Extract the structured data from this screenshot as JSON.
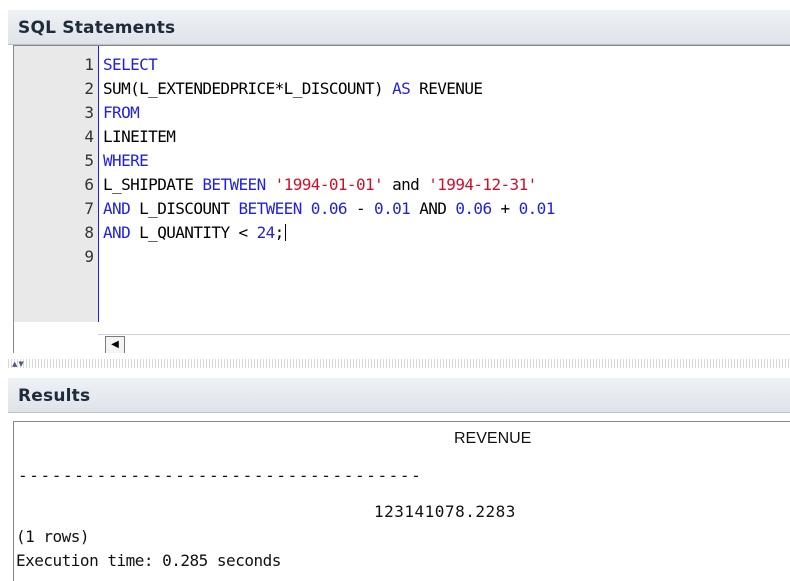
{
  "sql_panel": {
    "title": "SQL Statements",
    "line_numbers": [
      "1",
      "2",
      "3",
      "4",
      "5",
      "6",
      "7",
      "8",
      "9"
    ],
    "lines": [
      [
        {
          "t": "SELECT",
          "c": "kw"
        }
      ],
      [
        {
          "t": "SUM(L_EXTENDEDPRICE*L_DISCOUNT) ",
          "c": ""
        },
        {
          "t": "AS",
          "c": "kw"
        },
        {
          "t": " REVENUE",
          "c": ""
        }
      ],
      [
        {
          "t": "FROM",
          "c": "kw"
        }
      ],
      [
        {
          "t": "LINEITEM",
          "c": ""
        }
      ],
      [
        {
          "t": "WHERE",
          "c": "kw"
        }
      ],
      [
        {
          "t": "L_SHIPDATE ",
          "c": ""
        },
        {
          "t": "BETWEEN",
          "c": "kw"
        },
        {
          "t": " ",
          "c": ""
        },
        {
          "t": "'1994-01-01'",
          "c": "str"
        },
        {
          "t": " and ",
          "c": ""
        },
        {
          "t": "'1994-12-31'",
          "c": "str"
        }
      ],
      [
        {
          "t": "AND",
          "c": "kw"
        },
        {
          "t": " L_DISCOUNT ",
          "c": ""
        },
        {
          "t": "BETWEEN",
          "c": "kw"
        },
        {
          "t": " ",
          "c": ""
        },
        {
          "t": "0.06",
          "c": "num"
        },
        {
          "t": " - ",
          "c": ""
        },
        {
          "t": "0.01",
          "c": "num"
        },
        {
          "t": " AND ",
          "c": ""
        },
        {
          "t": "0.06",
          "c": "num"
        },
        {
          "t": " + ",
          "c": ""
        },
        {
          "t": "0.01",
          "c": "num"
        }
      ],
      [
        {
          "t": "AND",
          "c": "kw"
        },
        {
          "t": " L_QUANTITY < ",
          "c": ""
        },
        {
          "t": "24",
          "c": "num"
        },
        {
          "t": ";",
          "c": ""
        }
      ],
      []
    ],
    "scroll_left_icon": "arrow-left-icon",
    "splitter_icon": "split-arrows-icon"
  },
  "results_panel": {
    "title": "Results",
    "column_header": "REVENUE",
    "separator": "------------------------------------",
    "value": "123141078.2283",
    "rows_text": "(1 rows)",
    "execution_text": "Execution time: 0.285 seconds"
  },
  "colors": {
    "keyword": "#1f1fe6",
    "string": "#d0102a",
    "number": "#1f1fe6",
    "gutter_bg": "#e9e9e9"
  }
}
